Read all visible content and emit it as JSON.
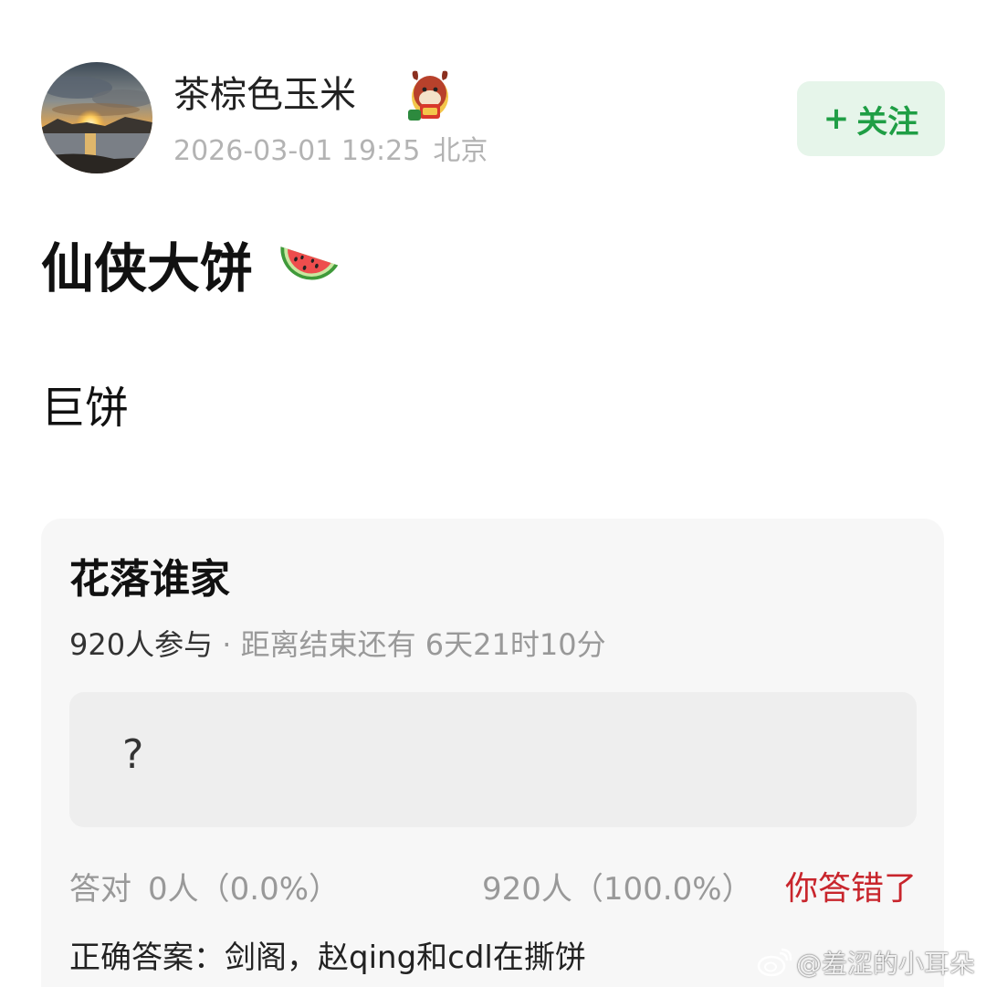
{
  "author": {
    "name": "茶棕色玉米",
    "timestamp": "2026-03-01 19:25",
    "location": "北京",
    "avatar": "sunset-landscape-avatar",
    "badge_icon": "lucky-cow-icon"
  },
  "follow": {
    "plus": "+",
    "label": "关注",
    "color": "#1f9e45",
    "bg": "#e6f5ea"
  },
  "post": {
    "title": "仙侠大饼",
    "title_emoji": "watermelon-icon",
    "body": "巨饼"
  },
  "quiz": {
    "title": "花落谁家",
    "participants": "920人参与",
    "separator": " · ",
    "countdown": "距离结束还有 6天21时10分",
    "question": "?",
    "correct_label": "答对",
    "correct_count": "0人（0.0%）",
    "wrong_count": "920人（100.0%）",
    "wrong_flag": "你答错了",
    "answer": "正确答案：剑阁，赵qing和cdl在撕饼"
  },
  "watermark": {
    "icon": "weibo-icon",
    "text": "@羞涩的小耳朵"
  },
  "colors": {
    "accent_green": "#1f9e45",
    "wrong_red": "#c8252c",
    "card_bg": "#f7f7f7"
  }
}
